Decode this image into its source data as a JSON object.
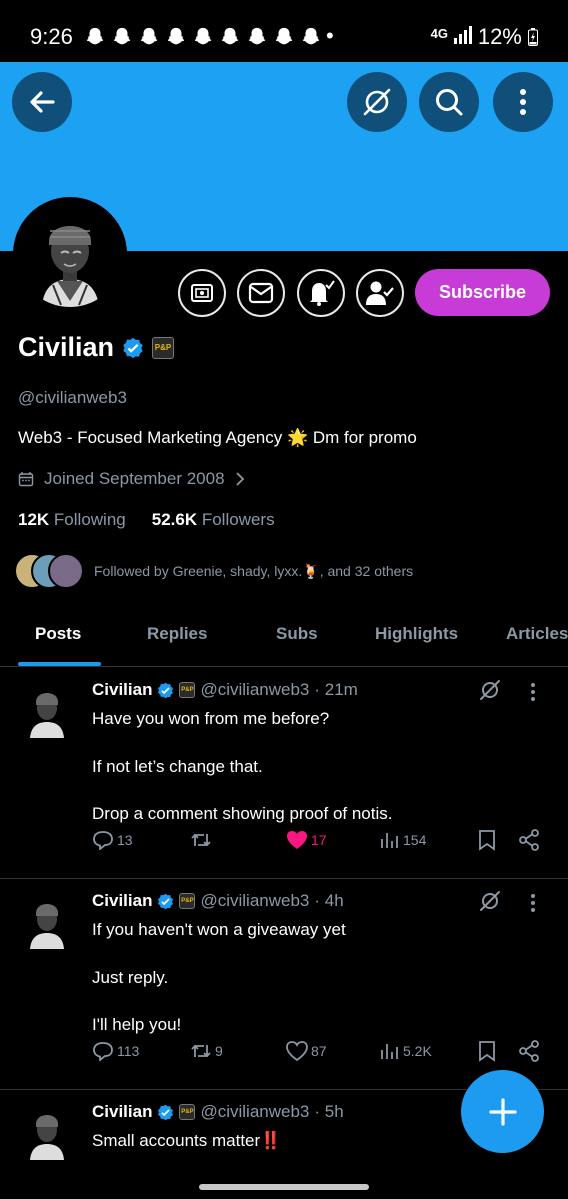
{
  "status_bar": {
    "time": "9:26",
    "network": "4G",
    "battery": "12%"
  },
  "profile": {
    "name": "Civilian",
    "affiliate_badge": "P&P",
    "handle": "@civilianweb3",
    "bio": "Web3 - Focused Marketing Agency 🌟 Dm for promo",
    "joined": "Joined September 2008",
    "following_count": "12K",
    "following_label": "Following",
    "followers_count": "52.6K",
    "followers_label": "Followers",
    "followed_by": "Followed by Greenie, shady, lyxx.🍹, and 32 others",
    "subscribe_label": "Subscribe"
  },
  "tabs": [
    "Posts",
    "Replies",
    "Subs",
    "Highlights",
    "Articles"
  ],
  "posts": [
    {
      "name": "Civilian",
      "handle": "@civilianweb3",
      "time": "· 21m",
      "lines": [
        "Have you won from me before?",
        "If not let’s change that.",
        "Drop a comment showing proof of notis."
      ],
      "replies": "13",
      "reposts": "",
      "likes": "17",
      "views": "154"
    },
    {
      "name": "Civilian",
      "handle": "@civilianweb3",
      "time": "· 4h",
      "lines": [
        "If you haven't won a giveaway yet",
        "Just reply.",
        "I'll help you!"
      ],
      "replies": "113",
      "reposts": "9",
      "likes": "87",
      "views": "5.2K"
    },
    {
      "name": "Civilian",
      "handle": "@civilianweb3",
      "time": "· 5h",
      "lines": [
        "Small accounts matter‼️"
      ]
    }
  ],
  "colors": {
    "banner": "#1da1f2",
    "accent": "#1d9bf0",
    "subscribe": "#c73bd6",
    "like": "#f91880"
  }
}
